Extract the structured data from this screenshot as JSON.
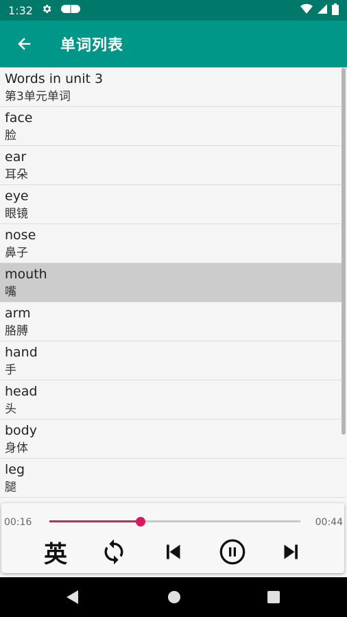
{
  "status_bar": {
    "time": "1:32",
    "icons": [
      "gear-icon",
      "cloud-icon",
      "wifi-icon",
      "signal-icon",
      "battery-icon"
    ]
  },
  "app_bar": {
    "title": "单词列表",
    "back_icon": "arrow-left-icon"
  },
  "words": [
    {
      "en": "Words in unit 3",
      "cn": "第3单元单词"
    },
    {
      "en": "face",
      "cn": "脸"
    },
    {
      "en": "ear",
      "cn": "耳朵"
    },
    {
      "en": "eye",
      "cn": "眼镜"
    },
    {
      "en": "nose",
      "cn": "鼻子"
    },
    {
      "en": "mouth",
      "cn": "嘴"
    },
    {
      "en": "arm",
      "cn": "胳膊"
    },
    {
      "en": "hand",
      "cn": "手"
    },
    {
      "en": "head",
      "cn": "头"
    },
    {
      "en": "body",
      "cn": "身体"
    },
    {
      "en": "leg",
      "cn": "腿"
    }
  ],
  "selected_index": 5,
  "player": {
    "current_time": "00:16",
    "total_time": "00:44",
    "progress": 0.364,
    "lang_label": "英",
    "controls": [
      "loop-icon",
      "skip-previous-icon",
      "pause-icon",
      "skip-next-icon"
    ]
  },
  "colors": {
    "app_bar": "#009688",
    "status_bar": "#00796b",
    "accent": "#d81b60",
    "selected_row": "#cccccc"
  }
}
